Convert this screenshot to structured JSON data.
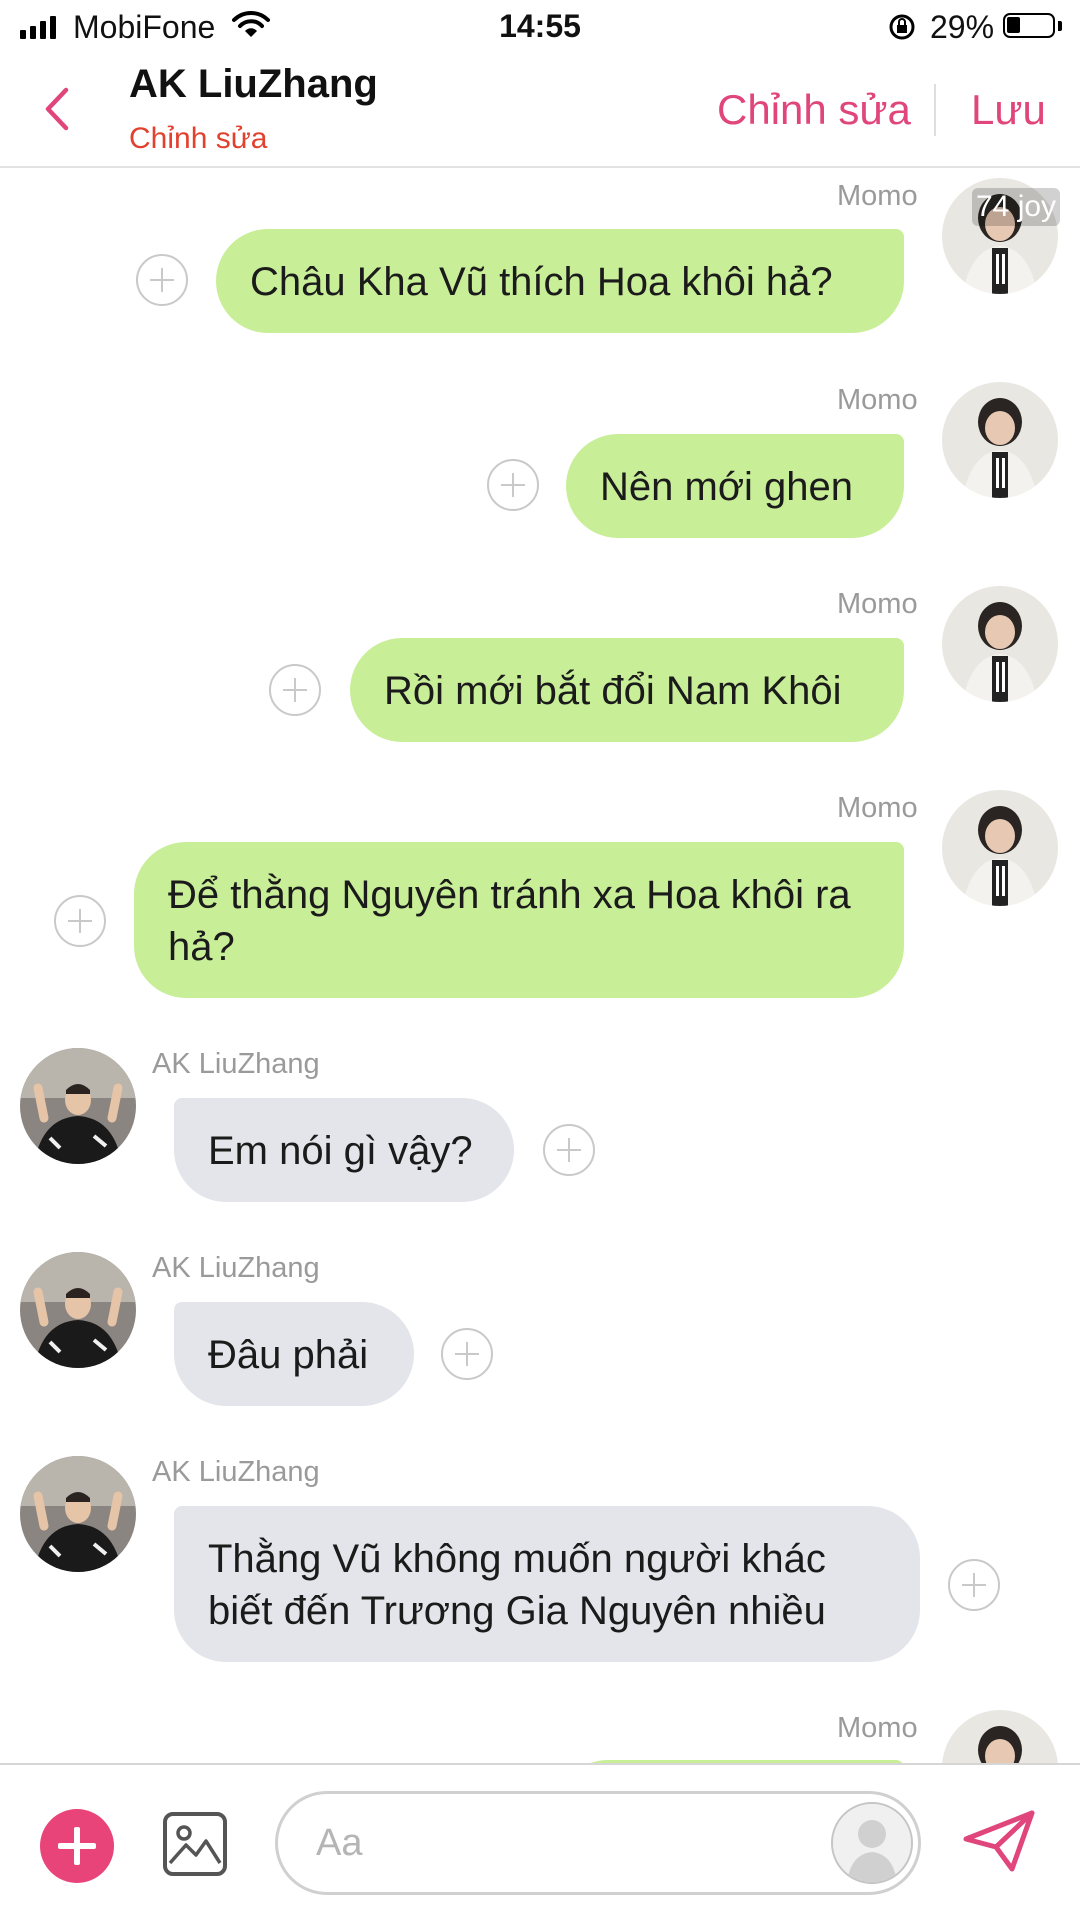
{
  "status_bar": {
    "carrier": "MobiFone",
    "time": "14:55",
    "battery_percent": "29%"
  },
  "header": {
    "title": "AK LiuZhang",
    "subtitle": "Chỉnh sửa",
    "edit_label": "Chỉnh sửa",
    "save_label": "Lưu"
  },
  "watermark": "74 joy",
  "messages": [
    {
      "sender": "Momo",
      "direction": "out",
      "text": "Châu Kha Vũ thích Hoa khôi hả?"
    },
    {
      "sender": "Momo",
      "direction": "out",
      "text": "Nên mới ghen"
    },
    {
      "sender": "Momo",
      "direction": "out",
      "text": "Rồi mới bắt đổi Nam Khôi"
    },
    {
      "sender": "Momo",
      "direction": "out",
      "text": "Để thằng Nguyên tránh xa Hoa khôi ra hả?"
    },
    {
      "sender": "AK LiuZhang",
      "direction": "in",
      "text": "Em nói gì vậy?"
    },
    {
      "sender": "AK LiuZhang",
      "direction": "in",
      "text": "Đâu phải"
    },
    {
      "sender": "AK LiuZhang",
      "direction": "in",
      "text": "Thằng Vũ không muốn người khác biết đến Trương Gia Nguyên nhiều"
    },
    {
      "sender": "Momo",
      "direction": "out",
      "text": ""
    }
  ],
  "composer": {
    "placeholder": "Aa"
  },
  "colors": {
    "accent": "#e0457b",
    "subtitle": "#e2412d",
    "outgoing_bubble": "#c8ee98",
    "incoming_bubble": "#e3e5ea"
  },
  "icons": [
    "back-chevron-icon",
    "plus-circle-icon",
    "image-icon",
    "send-icon",
    "wifi-icon",
    "rotation-lock-icon",
    "battery-icon"
  ]
}
